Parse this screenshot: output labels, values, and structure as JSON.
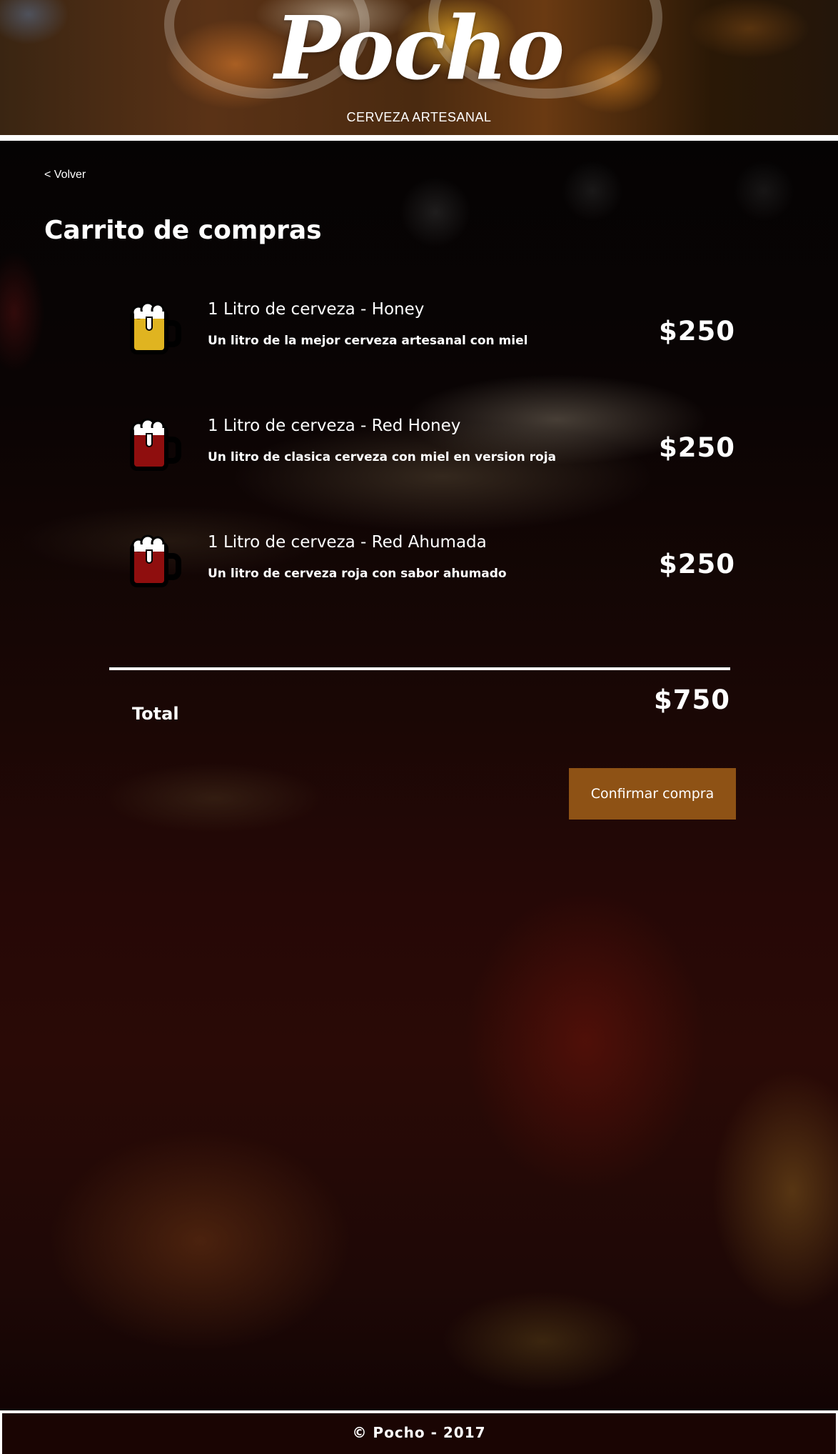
{
  "header": {
    "logo": "Pocho",
    "tagline": "CERVEZA ARTESANAL"
  },
  "nav": {
    "back_label": "< Volver"
  },
  "page_title": "Carrito de compras",
  "cart": {
    "items": [
      {
        "name": "1 Litro de cerveza - Honey",
        "description": "Un litro de la mejor cerveza artesanal con miel",
        "price": "$250",
        "icon": "beer-mug-icon",
        "beer_color": "#e0b420"
      },
      {
        "name": "1 Litro de cerveza - Red Honey",
        "description": "Un litro de clasica cerveza con miel en version roja",
        "price": "$250",
        "icon": "beer-mug-icon",
        "beer_color": "#8f0e0e"
      },
      {
        "name": "1 Litro de cerveza - Red Ahumada",
        "description": "Un litro de cerveza roja con sabor ahumado",
        "price": "$250",
        "icon": "beer-mug-icon",
        "beer_color": "#8f0e0e"
      }
    ],
    "total_label": "Total",
    "total_value": "$750",
    "confirm_label": "Confirmar compra"
  },
  "footer": {
    "text": "© Pocho - 2017"
  },
  "colors": {
    "accent_button": "#8e5215",
    "text": "#ffffff",
    "rule": "#ffffff"
  }
}
